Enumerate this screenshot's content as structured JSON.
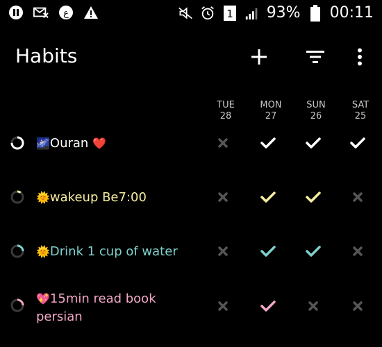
{
  "status_bar": {
    "battery": "93%",
    "time": "00:11",
    "sim": "1",
    "icons_left": [
      "pause-icon",
      "mail-x-icon",
      "app-icon",
      "warning-icon"
    ],
    "icons_right": [
      "mute-icon",
      "alarm-icon",
      "sim-icon",
      "signal-icon",
      "battery-icon"
    ]
  },
  "toolbar": {
    "title": "Habits",
    "add_icon": "plus-icon",
    "filter_icon": "filter-icon",
    "more_icon": "more-vert-icon"
  },
  "days": [
    {
      "name": "TUE",
      "num": "28"
    },
    {
      "name": "MON",
      "num": "27"
    },
    {
      "name": "SUN",
      "num": "26"
    },
    {
      "name": "SAT",
      "num": "25"
    }
  ],
  "habits": [
    {
      "emoji": "🌌",
      "name": "Ouran",
      "trail": "❤️",
      "color": "#ffffff",
      "ring_progress": 0.75,
      "marks": [
        "x",
        "check",
        "check",
        "check"
      ]
    },
    {
      "emoji": "🌞",
      "name": "wakeup Be7:00",
      "trail": "",
      "color": "#f6eda0",
      "ring_progress": 0.1,
      "marks": [
        "x",
        "check",
        "check",
        "x"
      ]
    },
    {
      "emoji": "🌞",
      "name": "Drink 1 cup of water",
      "trail": "",
      "color": "#7fd1cc",
      "ring_progress": 0.25,
      "marks": [
        "x",
        "check",
        "check",
        "x"
      ]
    },
    {
      "emoji": "💖",
      "name": "15min read book",
      "line2": "persian",
      "trail": "",
      "color": "#f2a8c8",
      "ring_progress": 0.25,
      "marks": [
        "x",
        "check",
        "x",
        "x"
      ]
    }
  ],
  "colors": {
    "background": "#000000",
    "x_mark": "#555555",
    "ring_track": "#3a3a3a"
  }
}
